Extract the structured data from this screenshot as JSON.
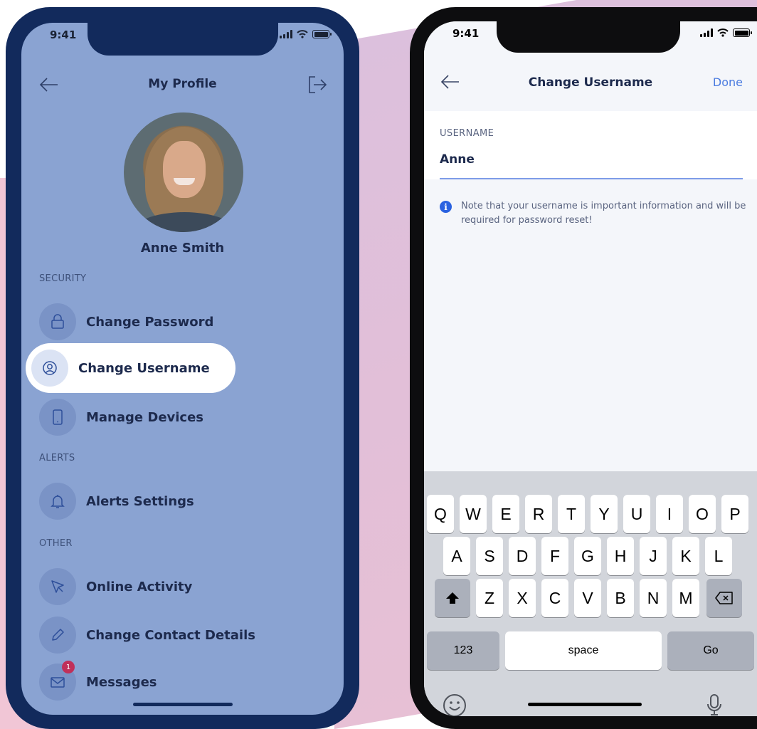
{
  "left_phone": {
    "status_time": "9:41",
    "nav_title": "My Profile",
    "profile_name": "Anne Smith",
    "sections": {
      "security": "SECURITY",
      "alerts": "ALERTS",
      "other": "OTHER"
    },
    "menu": {
      "change_password": "Change Password",
      "change_username": "Change Username",
      "manage_devices": "Manage Devices",
      "alerts_settings": "Alerts Settings",
      "online_activity": "Online Activity",
      "change_contact_details": "Change Contact Details",
      "messages": "Messages"
    },
    "messages_badge": "1",
    "colors": {
      "frame": "#122a5c",
      "overlay": "#8aa3d2",
      "badge": "#c0305a"
    }
  },
  "right_phone": {
    "status_time": "9:41",
    "nav_title": "Change Username",
    "done_label": "Done",
    "field_label": "USERNAME",
    "field_value": "Anne",
    "note": "Note that your username is important information and will be required for password reset!",
    "keyboard": {
      "row1": [
        "Q",
        "W",
        "E",
        "R",
        "T",
        "Y",
        "U",
        "I",
        "O",
        "P"
      ],
      "row2": [
        "A",
        "S",
        "D",
        "F",
        "G",
        "H",
        "J",
        "K",
        "L"
      ],
      "row3": [
        "Z",
        "X",
        "C",
        "V",
        "B",
        "N",
        "M"
      ],
      "numbers_key": "123",
      "space_key": "space",
      "go_key": "Go"
    },
    "colors": {
      "accent": "#4a7be0",
      "info": "#2a62e0"
    }
  }
}
